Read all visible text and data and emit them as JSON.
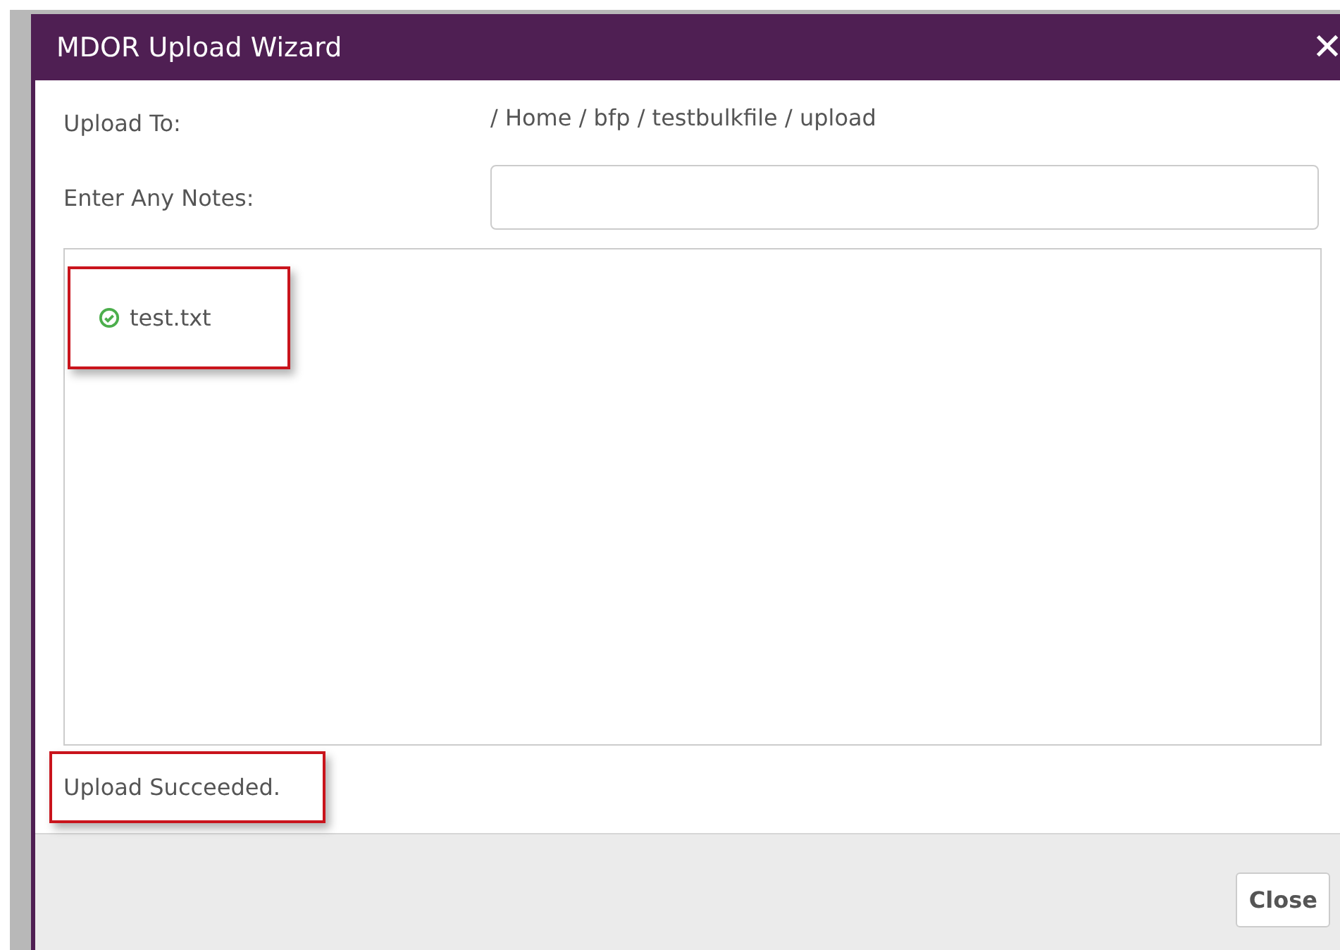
{
  "window": {
    "title": "MDOR Upload Wizard",
    "close_icon": "✕"
  },
  "upload_to": {
    "label": "Upload To:",
    "path": "/ Home / bfp / testbulkfile / upload"
  },
  "notes": {
    "label": "Enter Any Notes:"
  },
  "files": [
    {
      "name": "test.txt",
      "uploaded": true,
      "highlighted": true
    }
  ],
  "status": {
    "text": "Upload Succeeded.",
    "highlighted": true
  },
  "buttons": [
    {
      "label": "Close"
    }
  ]
}
